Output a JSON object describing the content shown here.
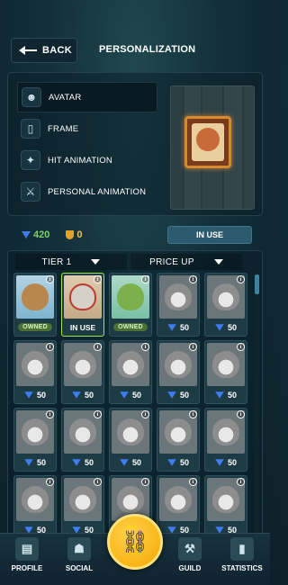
{
  "header": {
    "back_label": "BACK",
    "title": "PERSONALIZATION"
  },
  "menu": [
    {
      "label": "AVATAR",
      "icon": "mask-icon",
      "glyph": "☻"
    },
    {
      "label": "FRAME",
      "icon": "frame-icon",
      "glyph": "▯"
    },
    {
      "label": "HIT ANIMATION",
      "icon": "burst-icon",
      "glyph": "✦"
    },
    {
      "label": "PERSONAL ANIMATION",
      "icon": "axes-icon",
      "glyph": "⚔"
    }
  ],
  "currency": {
    "gems": "420",
    "coins": "0"
  },
  "equip_button": "IN USE",
  "filters": {
    "tier": "TIER 1",
    "sort": "PRICE UP"
  },
  "cards": [
    {
      "status": "OWNED",
      "price": "",
      "style": "color1",
      "face": "bear"
    },
    {
      "status": "IN USE",
      "price": "",
      "style": "color2",
      "face": "cat"
    },
    {
      "status": "OWNED",
      "price": "",
      "style": "color3",
      "face": "frog"
    },
    {
      "status": "",
      "price": "50",
      "style": "",
      "face": "grey"
    },
    {
      "status": "",
      "price": "50",
      "style": "",
      "face": "grey"
    },
    {
      "status": "",
      "price": "50",
      "style": "",
      "face": "grey"
    },
    {
      "status": "",
      "price": "50",
      "style": "",
      "face": "grey"
    },
    {
      "status": "",
      "price": "50",
      "style": "",
      "face": "grey"
    },
    {
      "status": "",
      "price": "50",
      "style": "",
      "face": "grey"
    },
    {
      "status": "",
      "price": "50",
      "style": "",
      "face": "grey"
    },
    {
      "status": "",
      "price": "50",
      "style": "",
      "face": "grey"
    },
    {
      "status": "",
      "price": "50",
      "style": "",
      "face": "grey"
    },
    {
      "status": "",
      "price": "50",
      "style": "",
      "face": "grey"
    },
    {
      "status": "",
      "price": "50",
      "style": "",
      "face": "grey"
    },
    {
      "status": "",
      "price": "50",
      "style": "",
      "face": "grey"
    },
    {
      "status": "",
      "price": "50",
      "style": "",
      "face": "grey"
    },
    {
      "status": "",
      "price": "50",
      "style": "",
      "face": "grey"
    },
    {
      "status": "",
      "price": "50",
      "style": "",
      "face": "grey"
    },
    {
      "status": "",
      "price": "50",
      "style": "",
      "face": "grey"
    },
    {
      "status": "",
      "price": "50",
      "style": "",
      "face": "grey"
    }
  ],
  "nav": [
    {
      "label": "PROFILE",
      "icon": "profile-card-icon",
      "glyph": "▤"
    },
    {
      "label": "SOCIAL",
      "icon": "social-shield-icon",
      "glyph": "☗"
    },
    {
      "label": "GUILD",
      "icon": "guild-banner-icon",
      "glyph": "⚒"
    },
    {
      "label": "STATISTICS",
      "icon": "statistics-icon",
      "glyph": "▮"
    }
  ],
  "center_action": {
    "icon": "link-icon",
    "glyph": "⛓"
  },
  "colors": {
    "accent_green": "#9ee84a",
    "gem_blue": "#3e7df2",
    "gold": "#f5a700"
  }
}
